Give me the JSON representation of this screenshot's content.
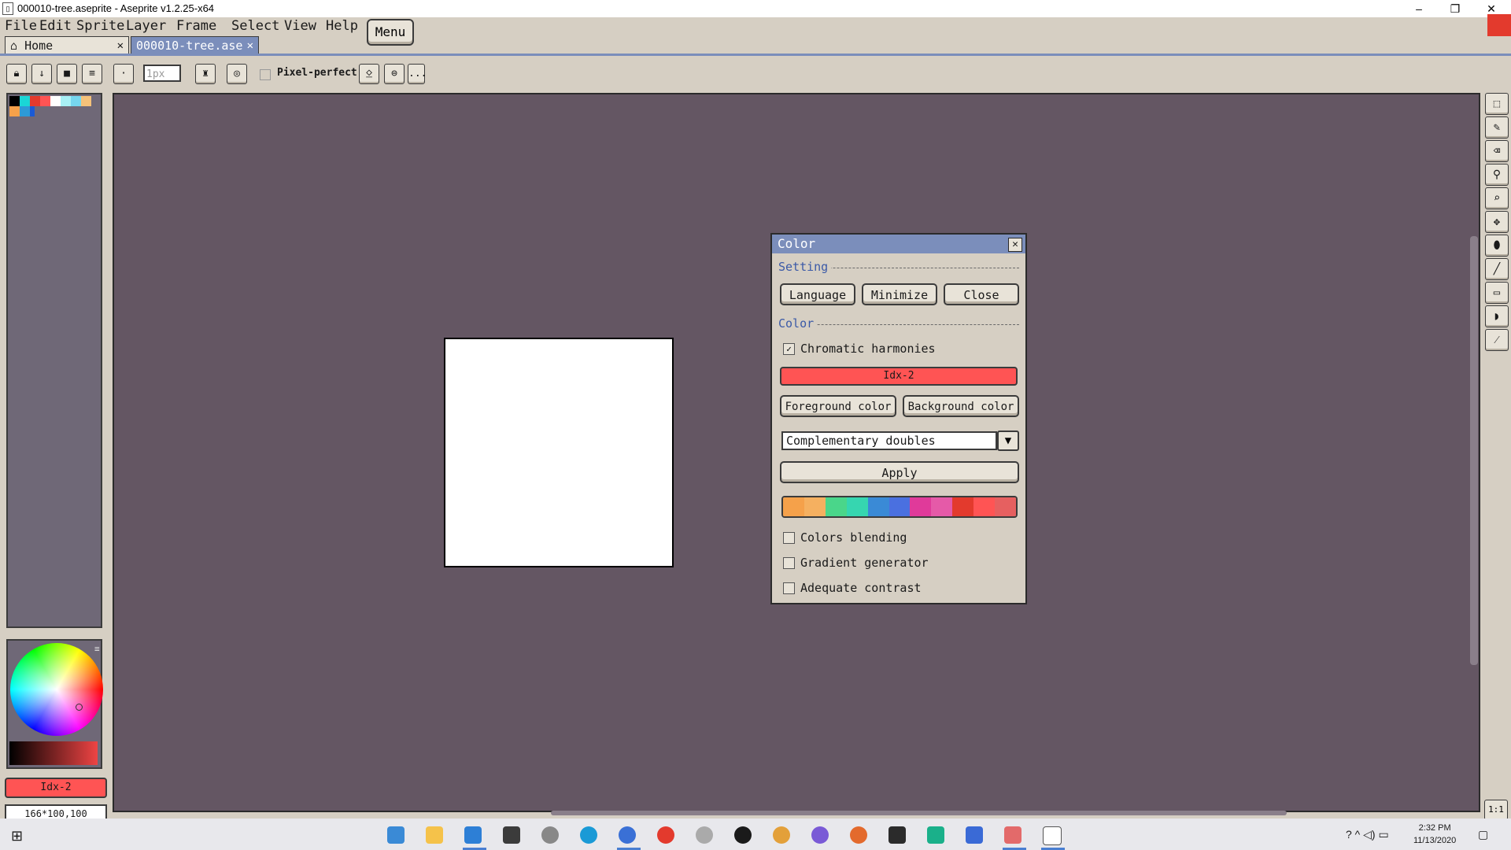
{
  "window": {
    "title": "000010-tree.aseprite - Aseprite v1.2.25-x64",
    "minimize": "–",
    "maximize": "❐",
    "close": "✕"
  },
  "menu": {
    "items": [
      "File",
      "Edit",
      "Sprite",
      "Layer",
      "Frame",
      "Select",
      "View",
      "Help"
    ],
    "menu_button": "Menu"
  },
  "tabs": [
    {
      "label": "Home",
      "icon": "home-icon",
      "close": "✕"
    },
    {
      "label": "000010-tree.ase",
      "close": "✕"
    }
  ],
  "context_bar": {
    "brush_size_placeholder": "1px",
    "pixel_perfect_label": "Pixel-perfect",
    "more": "..."
  },
  "left_panel": {
    "palette_colors": [
      "#000000",
      "#1ad6d6",
      "#e33a2d",
      "#ff5454",
      "#ffffff",
      "#a8f0f5",
      "#76d6ee",
      "#f5c27a",
      "#f5a14a",
      "#2d9ad6",
      "#1a5ad6",
      "#6f6877"
    ],
    "fg_color_label": "Idx-2",
    "status_text": "166*100,100"
  },
  "color_dialog": {
    "title": "Color",
    "section_setting": "Setting",
    "btn_language": "Language",
    "btn_minimize": "Minimize",
    "btn_close": "Close",
    "section_color": "Color",
    "chromatic_label": "Chromatic harmonies",
    "chromatic_checked": true,
    "index_label": "Idx-2",
    "btn_foreground": "Foreground color",
    "btn_background": "Background color",
    "harmony_selected": "Complementary doubles",
    "btn_apply": "Apply",
    "harmony_colors": [
      "#f5a14a",
      "#f5b060",
      "#4ad68a",
      "#36d6b0",
      "#3a8ad6",
      "#4a70e0",
      "#e03a9a",
      "#e55aa8",
      "#e33a2d",
      "#ff5454",
      "#e66060"
    ],
    "colors_blending_label": "Colors blending",
    "gradient_generator_label": "Gradient generator",
    "adequate_contrast_label": "Adequate contrast"
  },
  "right_toolbar": {
    "zoom_label": "1:1"
  },
  "taskbar": {
    "time": "2:32 PM",
    "date": "11/13/2020"
  }
}
